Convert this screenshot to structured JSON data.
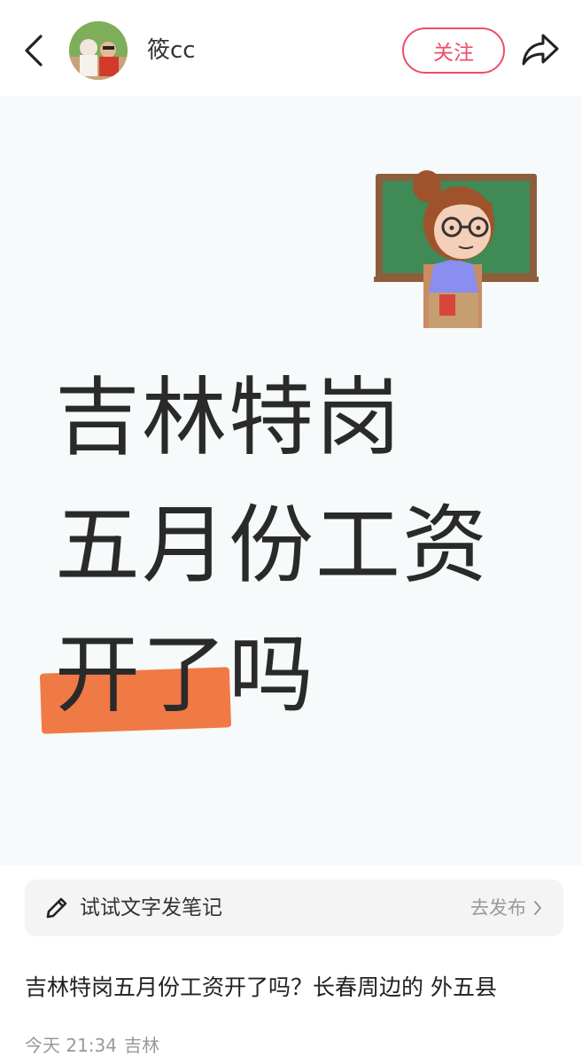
{
  "header": {
    "username": "筱cc",
    "follow_label": "关注",
    "back_icon": "chevron-left-icon",
    "share_icon": "share-arrow-icon"
  },
  "cover": {
    "line1": "吉林特岗",
    "line2": "五月份工资",
    "line3_highlighted": "开了",
    "line3_rest": "吗",
    "highlight_color": "#f07a45",
    "illustration": "teacher-at-chalkboard"
  },
  "compose": {
    "label": "试试文字发笔记",
    "action": "去发布",
    "icon": "pencil-icon"
  },
  "post": {
    "title": "吉林特岗五月份工资开了吗？长春周边的 外五县",
    "time": "今天 21:34",
    "location": "吉林"
  },
  "colors": {
    "accent": "#ee4d6a",
    "cover_bg": "#f6fafb"
  }
}
